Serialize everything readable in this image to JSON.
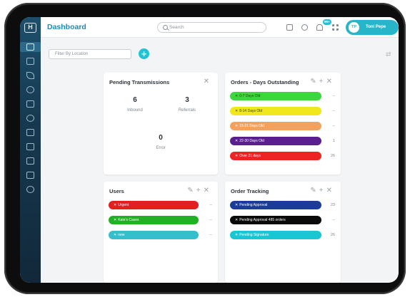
{
  "app": {
    "title": "Dashboard",
    "logo_glyph": "H",
    "search_placeholder": "Search",
    "notification_badge": "99+",
    "user": {
      "initials": "TP",
      "name": "Toni Pepe"
    }
  },
  "sidebar": {
    "items": [
      "dashboard-icon",
      "clipboard-icon",
      "send-icon",
      "tag-icon",
      "monitor-icon",
      "heart-icon",
      "card-icon",
      "inbox-icon",
      "cart-icon",
      "calculator-icon",
      "help-icon"
    ]
  },
  "toolbar": {
    "filter_placeholder": "Filter By Location",
    "add_label": "+",
    "swap_glyph": "⇄"
  },
  "cards": {
    "pending": {
      "title": "Pending Transmissions",
      "close": "✕",
      "stats": [
        {
          "value": "6",
          "label": "Inbound"
        },
        {
          "value": "3",
          "label": "Referrals"
        },
        {
          "value": "0",
          "label": "Error"
        }
      ]
    },
    "orders": {
      "title": "Orders - Days Outstanding",
      "icons": "✎+✕",
      "rows": [
        {
          "label": "0-7 Days Old",
          "count": "--",
          "color": "#3ed63e",
          "text": "#1f3d1f"
        },
        {
          "label": "8-14 Days Old",
          "count": "--",
          "color": "#f0e81c",
          "text": "#3d3a10"
        },
        {
          "label": "15-21 Days Old",
          "count": "--",
          "color": "#f5a15e",
          "text": "#ffffff"
        },
        {
          "label": "22-30 Days Old",
          "count": "1",
          "color": "#5a1e8f",
          "text": "#ffffff"
        },
        {
          "label": "Over 21 days",
          "count": "26",
          "color": "#ec2424",
          "text": "#ffffff"
        }
      ]
    },
    "users": {
      "title": "Users",
      "icons": "✎+✕",
      "rows": [
        {
          "label": "Urgent",
          "count": "--",
          "color": "#e32020",
          "text": "#ffffff"
        },
        {
          "label": "Kate's Cases",
          "count": "--",
          "color": "#22b024",
          "text": "#ffffff"
        },
        {
          "label": "new",
          "count": "--",
          "color": "#35bfcc",
          "text": "#ffffff"
        }
      ]
    },
    "tracking": {
      "title": "Order Tracking",
      "icons": "✎+✕",
      "rows": [
        {
          "label": "Pending Approval",
          "count": "23",
          "color": "#1b3c9a",
          "text": "#ffffff"
        },
        {
          "label": "Pending Approval 485 orders",
          "count": "--",
          "color": "#0a0a0a",
          "text": "#ffffff"
        },
        {
          "label": "Pending Signature",
          "count": "26",
          "color": "#18c7d3",
          "text": "#ffffff"
        }
      ]
    }
  }
}
